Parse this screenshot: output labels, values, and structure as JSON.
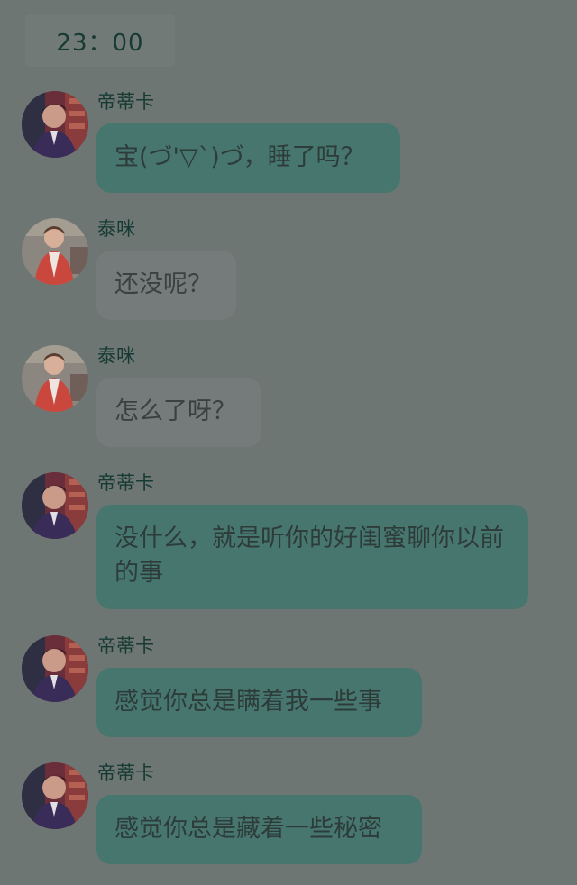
{
  "header": {
    "time": "23：00"
  },
  "messages": [
    {
      "sender": "帝蒂卡",
      "text": "宝(づ'▽`)づ，睡了吗？",
      "avatar": "male-avatar",
      "style": "green"
    },
    {
      "sender": "泰咪",
      "text": "还没呢？",
      "avatar": "female-avatar",
      "style": "gray"
    },
    {
      "sender": "泰咪",
      "text": "怎么了呀？",
      "avatar": "female-avatar",
      "style": "gray"
    },
    {
      "sender": "帝蒂卡",
      "text": "没什么，就是听你的好闺蜜聊你以前的事",
      "avatar": "male-avatar",
      "style": "green"
    },
    {
      "sender": "帝蒂卡",
      "text": "感觉你总是瞒着我一些事",
      "avatar": "male-avatar",
      "style": "green"
    },
    {
      "sender": "帝蒂卡",
      "text": "感觉你总是藏着一些秘密",
      "avatar": "male-avatar",
      "style": "green"
    }
  ],
  "colors": {
    "background": "#6e7674",
    "green_bubble": "#47766f",
    "gray_bubble": "#757b7a",
    "name_text": "#173a33"
  }
}
